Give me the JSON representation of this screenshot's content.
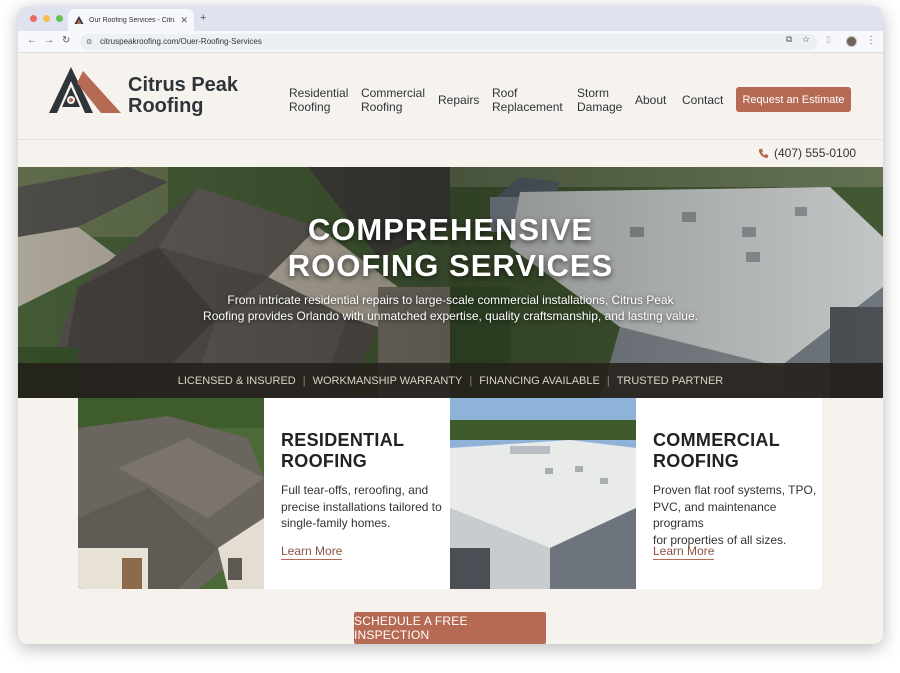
{
  "browser": {
    "tab_title": "Our Roofing Services - Citrus Peak Roofing",
    "url": "citruspeakroofing.com/Ouer-Roofing-Services",
    "colors": {
      "close": "#ee6a5f",
      "minimize": "#f5bd4f",
      "maximize": "#61c454"
    }
  },
  "header": {
    "logo_line1": "Citrus Peak",
    "logo_line2": "Roofing",
    "nav": [
      {
        "line1": "Residential",
        "line2": "Roofing"
      },
      {
        "line1": "Commercial",
        "line2": "Roofing"
      },
      {
        "line1": "Repairs",
        "line2": ""
      },
      {
        "line1": "Roof",
        "line2": "Replacement"
      },
      {
        "line1": "Storm",
        "line2": "Damage"
      },
      {
        "line1": "About",
        "line2": ""
      },
      {
        "line1": "Contact",
        "line2": ""
      }
    ],
    "cta": "Request an Estimate",
    "phone": "(407) 555-0100"
  },
  "hero": {
    "title_line1": "COMPREHENSIVE",
    "title_line2": "ROOFING SERVICES",
    "sub_line1": "From intricate residential repairs to large-scale commercial installations, Citrus Peak",
    "sub_line2": "Roofing provides Orlando with unmatched expertise, quality craftsmanship, and lasting value.",
    "trust": [
      "LICENSED & INSURED",
      "WORKMANSHIP WARRANTY",
      "FINANCING AVAILABLE",
      "TRUSTED PARTNER"
    ]
  },
  "cards": [
    {
      "title_line1": "RESIDENTIAL",
      "title_line2": "ROOFING",
      "text_line1": "Full tear-offs, reroofing, and",
      "text_line2": "precise installations tailored to",
      "text_line3": "single-family homes.",
      "link": "Learn More"
    },
    {
      "title_line1": "COMMERCIAL",
      "title_line2": "ROOFING",
      "text_line1": "Proven flat roof systems, TPO,",
      "text_line2": "PVC, and maintenance programs",
      "text_line3": "for properties of all sizes.",
      "link": "Learn More"
    }
  ],
  "inspection_button": "SCHEDULE A FREE INSPECTION",
  "brand_colors": {
    "accent": "#b66a54",
    "dark": "#2f3438",
    "background": "#f6f3ee"
  }
}
